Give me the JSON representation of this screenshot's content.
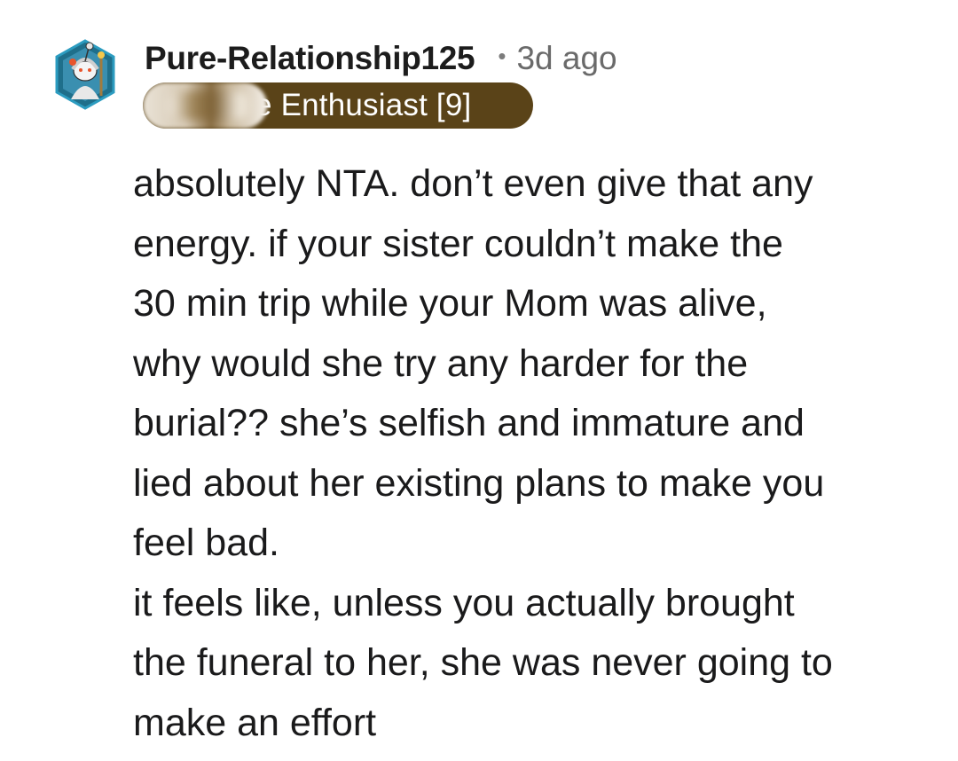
{
  "comment": {
    "author": "Pure-Relationship125",
    "separator": "•",
    "time_ago": "3d ago",
    "flair_text": "le Enthusiast [9]",
    "avatar_icon": "snoo-avatar-icon",
    "colors": {
      "flair_background": "#5a4318",
      "flair_text": "#ffffff",
      "username": "#1c1c1c",
      "timestamp": "#6a6a6a",
      "body_text": "#1a1a1b"
    },
    "body_lines": [
      "absolutely NTA. don’t even give that any",
      "energy. if your sister couldn’t make the",
      "30 min trip while your Mom was alive,",
      "why would she try any harder for the",
      "burial?? she’s selfish and immature and",
      "lied about her existing plans to make you",
      "feel bad.",
      "it feels like, unless you actually brought",
      "the funeral to her, she was never going to",
      "make an effort"
    ]
  }
}
